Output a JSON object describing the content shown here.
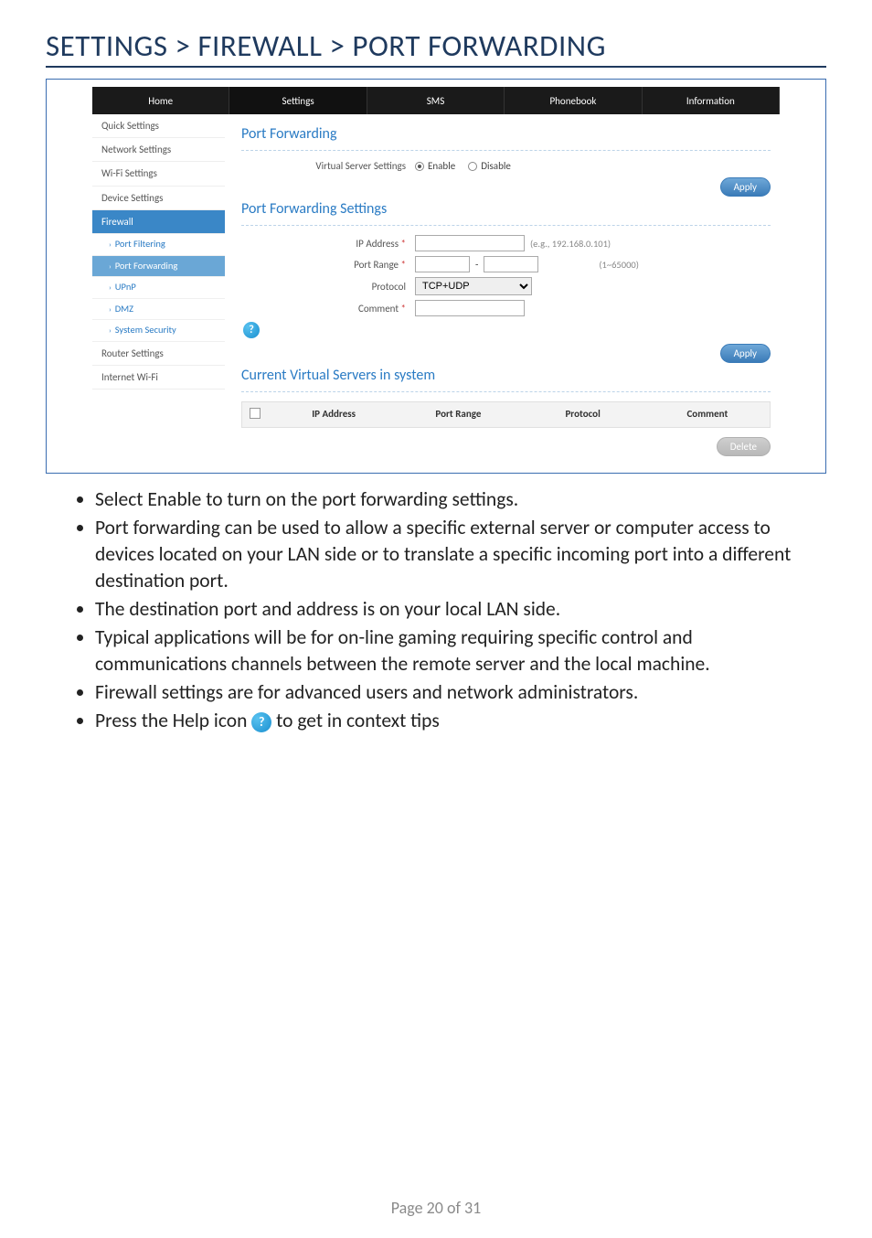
{
  "page_title": "SETTINGS > FIREWALL > PORT FORWARDING",
  "tabs": {
    "home": "Home",
    "settings": "Settings",
    "sms": "SMS",
    "phonebook": "Phonebook",
    "information": "Information"
  },
  "sidebar": {
    "quick": "Quick Settings",
    "network": "Network Settings",
    "wifi": "Wi-Fi Settings",
    "device": "Device Settings",
    "firewall": "Firewall",
    "subs": {
      "port_filtering": "Port Filtering",
      "port_forwarding": "Port Forwarding",
      "upnp": "UPnP",
      "dmz": "DMZ",
      "system_security": "System Security"
    },
    "router": "Router Settings",
    "internet_wifi": "Internet Wi-Fi"
  },
  "sections": {
    "title1": "Port Forwarding",
    "vss_label": "Virtual Server Settings",
    "enable": "Enable",
    "disable": "Disable",
    "apply": "Apply",
    "title2": "Port Forwarding Settings",
    "ip_address": "IP Address",
    "ip_hint": "(e.g., 192.168.0.101)",
    "port_range": "Port Range",
    "port_dash": "-",
    "port_hint": "(1~65000)",
    "protocol": "Protocol",
    "protocol_value": "TCP+UDP",
    "comment": "Comment",
    "help_glyph": "?",
    "title3": "Current Virtual Servers in system",
    "th_ip": "IP Address",
    "th_port": "Port Range",
    "th_proto": "Protocol",
    "th_comment": "Comment",
    "delete": "Delete"
  },
  "bullets": {
    "b1": "Select Enable to turn on the port forwarding settings.",
    "b2": "Port forwarding can be used to allow a specific external server or computer access to devices located on your LAN side or to translate a specific incoming port into a different destination port.",
    "b3": "The destination port and address is on your local LAN side.",
    "b4": "Typical applications will be for on-line gaming requiring specific control and communications channels between the remote server and the local machine.",
    "b5": "Firewall settings are for advanced users and network administrators.",
    "b6a": "Press the Help icon ",
    "b6b": " to get in context tips"
  },
  "footer": "Page 20 of 31"
}
